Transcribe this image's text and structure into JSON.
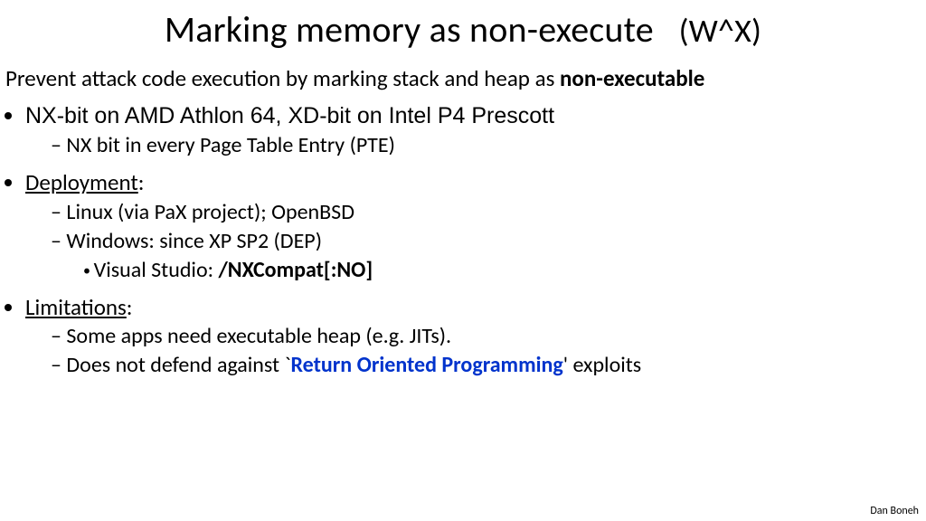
{
  "title_main": "Marking memory as non-execute",
  "title_sub": "(W^X)",
  "intro_prefix": "Prevent attack code execution by marking stack and heap as ",
  "intro_bold": "non-executable",
  "b1_nx": "NX",
  "b1_mid1": "-bit on ",
  "b1_amd": "AMD Athlon 64,     ",
  "b1_xd": "XD",
  "b1_mid2": "-bit on ",
  "b1_intel": "Intel P4  Prescott",
  "b1_sub1": "NX bit in every Page Table Entry (PTE)",
  "b2_head": "Deployment",
  "b2_colon": ":",
  "b2_s1": "Linux (via PaX project);    OpenBSD",
  "b2_s2": "Windows:  since XP SP2    (DEP)",
  "b2_s2a_label": "Visual Studio:   ",
  "b2_s2a_bold": "/NXCompat[:NO]",
  "b3_head": "Limitations",
  "b3_colon": ":",
  "b3_s1": "Some apps need executable heap   (e.g. JITs).",
  "b3_s2_pre": "Does not defend against  `",
  "b3_s2_blue": "Return Oriented Programming",
  "b3_s2_post": "'  exploits",
  "footer": "Dan Boneh"
}
